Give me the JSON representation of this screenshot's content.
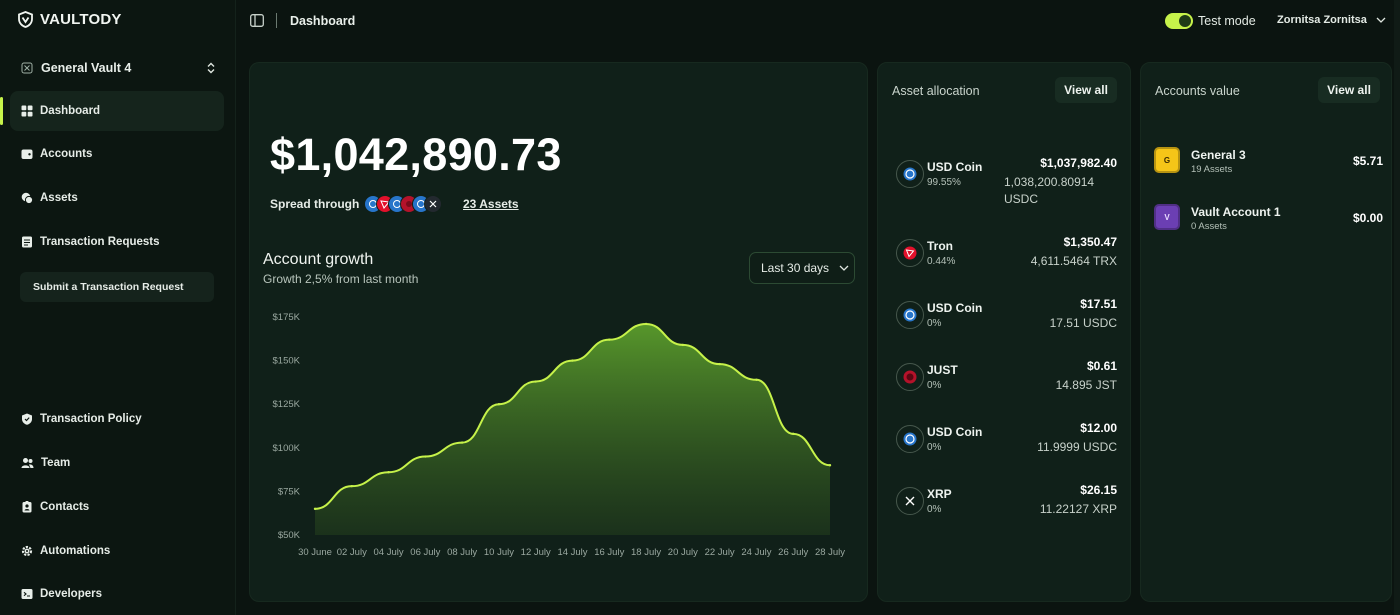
{
  "brand": {
    "name": "VAULTODY"
  },
  "sidebar": {
    "vault_name": "General Vault 4",
    "items": [
      {
        "label": "Dashboard",
        "icon": "grid-icon"
      },
      {
        "label": "Accounts",
        "icon": "wallet-icon"
      },
      {
        "label": "Assets",
        "icon": "coins-icon"
      },
      {
        "label": "Transaction Requests",
        "icon": "list-icon"
      },
      {
        "label": "Transaction Policy",
        "icon": "shield-icon"
      },
      {
        "label": "Team",
        "icon": "users-icon"
      },
      {
        "label": "Contacts",
        "icon": "contact-icon"
      },
      {
        "label": "Automations",
        "icon": "gear-icon"
      },
      {
        "label": "Developers",
        "icon": "terminal-icon"
      }
    ],
    "submit_label": "Submit a Transaction Request",
    "accent": "#c6f24a"
  },
  "topbar": {
    "breadcrumb": "Dashboard",
    "test_mode_label": "Test mode",
    "test_mode_on": true,
    "user_name": "Zornitsa Zornitsa"
  },
  "main": {
    "balance": "$1,042,890.73",
    "spread_label": "Spread through",
    "assets_link": "23 Assets",
    "growth_title": "Account growth",
    "growth_subtitle": "Growth 2,5% from last month",
    "range_label": "Last 30 days"
  },
  "chart_data": {
    "type": "area",
    "title": "Account growth",
    "x": [
      "30 June",
      "02 July",
      "04 July",
      "06 July",
      "08 July",
      "10 July",
      "12 July",
      "14 July",
      "16 July",
      "18 July",
      "20 July",
      "22 July",
      "24 July",
      "26 July",
      "28 July"
    ],
    "y_tick_labels": [
      "$175K",
      "$150K",
      "$125K",
      "$100K",
      "$75K",
      "$50K"
    ],
    "ylim": [
      50000,
      175000
    ],
    "series": [
      {
        "values": [
          65000,
          78000,
          86000,
          95000,
          103000,
          125000,
          138000,
          150000,
          162000,
          171000,
          159000,
          148000,
          139000,
          108000,
          90000
        ]
      }
    ],
    "color": "#c6f24a",
    "grid": false
  },
  "allocation": {
    "title": "Asset allocation",
    "view_all": "View all",
    "items": [
      {
        "name": "USD Coin",
        "pct": "99.55%",
        "usd": "$1,037,982.40",
        "amount": "1,038,200.80914 USDC",
        "icon": "usdc-icon",
        "color": "#2775ca"
      },
      {
        "name": "Tron",
        "pct": "0.44%",
        "usd": "$1,350.47",
        "amount": "4,611.5464 TRX",
        "icon": "tron-icon",
        "color": "#e3102b"
      },
      {
        "name": "USD Coin",
        "pct": "0%",
        "usd": "$17.51",
        "amount": "17.51 USDC",
        "icon": "usdc-icon",
        "color": "#2775ca"
      },
      {
        "name": "JUST",
        "pct": "0%",
        "usd": "$0.61",
        "amount": "14.895 JST",
        "icon": "just-icon",
        "color": "#b5122a"
      },
      {
        "name": "USD Coin",
        "pct": "0%",
        "usd": "$12.00",
        "amount": "11.9999 USDC",
        "icon": "usdc-icon",
        "color": "#2775ca"
      },
      {
        "name": "XRP",
        "pct": "0%",
        "usd": "$26.15",
        "amount": "11.22127 XRP",
        "icon": "xrp-icon",
        "color": "#ffffff"
      }
    ]
  },
  "accounts": {
    "title": "Accounts value",
    "view_all": "View all",
    "items": [
      {
        "name": "General 3",
        "sub": "19 Assets",
        "value": "$5.71",
        "initial": "G",
        "color": "#f5c518"
      },
      {
        "name": "Vault Account 1",
        "sub": "0 Assets",
        "value": "$0.00",
        "initial": "V",
        "color": "#6b3fb3"
      }
    ]
  }
}
